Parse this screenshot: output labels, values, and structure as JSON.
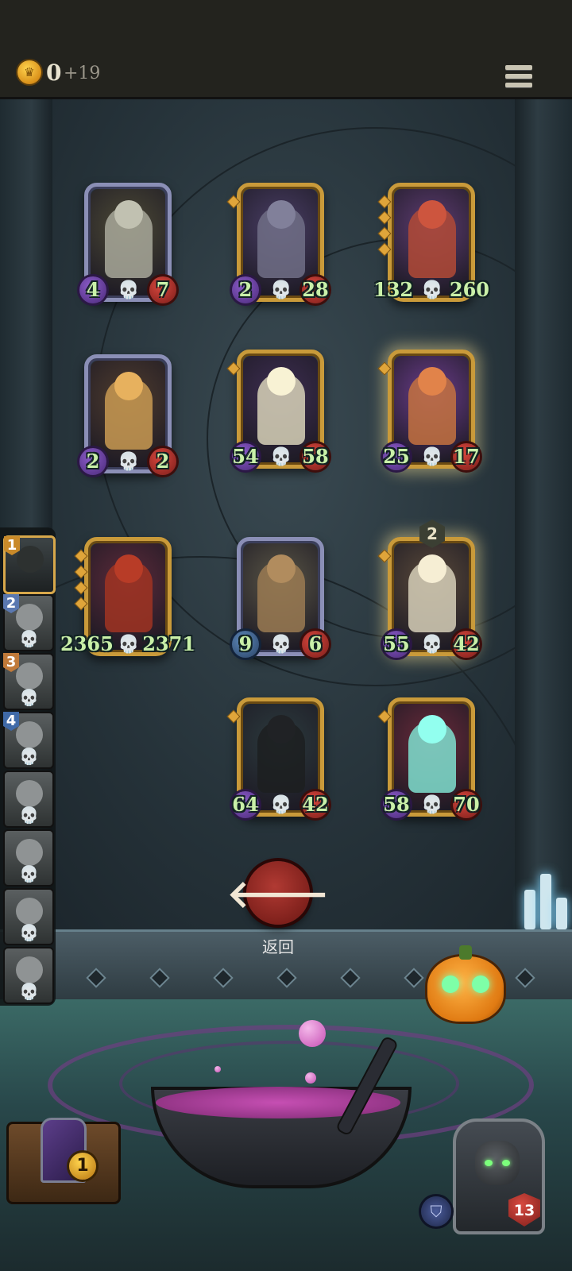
{
  "header": {
    "coins": "0",
    "coin_bonus": "+19"
  },
  "board": {
    "cards": [
      {
        "name": "robot",
        "attack": "4",
        "health": "7",
        "frame": "silver",
        "art": "#4d4a36",
        "fig": "#a8a89a"
      },
      {
        "name": "rat",
        "attack": "2",
        "health": "28",
        "frame": "gold",
        "art": "#4a3e66",
        "fig": "#706f86"
      },
      {
        "name": "box-golem",
        "attack": "132",
        "health": "260",
        "frame": "gold",
        "art": "#5e3c72",
        "fig": "#b24a36"
      },
      {
        "name": "pinocchio",
        "attack": "2",
        "health": "2",
        "frame": "silver",
        "art": "#4f3c2e",
        "fig": "#c99a52"
      },
      {
        "name": "skeleton",
        "attack": "54",
        "health": "58",
        "frame": "gold",
        "art": "#3e2e52",
        "fig": "#d8d2b8"
      },
      {
        "name": "archer",
        "attack": "25",
        "health": "17",
        "frame": "gold",
        "art": "#6a3c8a",
        "fig": "#c47240"
      },
      {
        "name": "assassin",
        "attack": "2365",
        "health": "2371",
        "frame": "gold",
        "art": "#5c2a3a",
        "fig": "#a03422"
      },
      {
        "name": "cannon",
        "attack": "9",
        "health": "6",
        "frame": "silver",
        "art": "#5a5646",
        "fig": "#9a7a52"
      },
      {
        "name": "ace-knight",
        "attack": "55",
        "health": "42",
        "frame": "gold",
        "art": "#5a4a3a",
        "fig": "#d6cfb8",
        "level": "2"
      },
      {
        "name": "reaper",
        "attack": "64",
        "health": "42",
        "frame": "gold",
        "art": "#2c3b3e",
        "fig": "#1c1e20"
      },
      {
        "name": "ghost-chef",
        "attack": "58",
        "health": "70",
        "frame": "gold",
        "art": "#6a2a3a",
        "fig": "#7fe0d0"
      }
    ]
  },
  "sidebar": {
    "slots": [
      "1",
      "2",
      "3",
      "4",
      "",
      "",
      "",
      ""
    ]
  },
  "actions": {
    "back_label": "返回"
  },
  "deck": {
    "count": "1"
  },
  "hero": {
    "health": "13"
  },
  "colors": {
    "gold_frame": "#c99a3a",
    "silver_frame": "#8b8fb6",
    "stat_text": "#c9f0a8"
  }
}
